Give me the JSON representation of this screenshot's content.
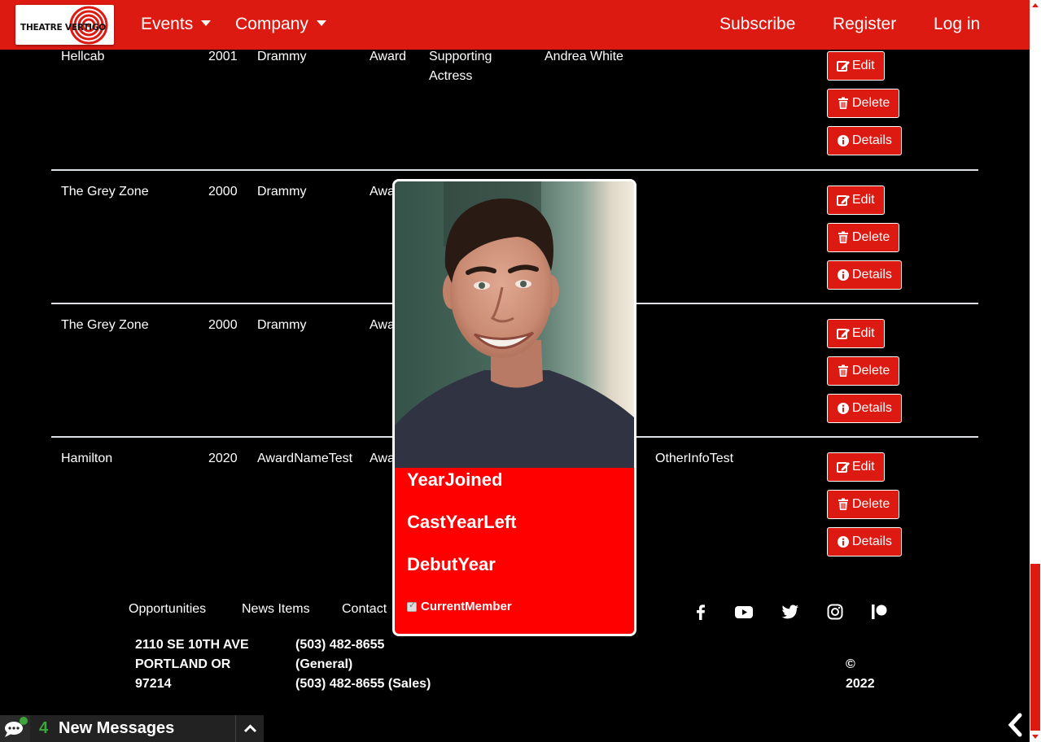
{
  "brand": {
    "logo_text": "THEATRE VERTIGO"
  },
  "nav": {
    "events": "Events",
    "company": "Company",
    "subscribe": "Subscribe",
    "register": "Register",
    "login": "Log in"
  },
  "table": {
    "rows": [
      {
        "production": "Hellcab",
        "year": "2001",
        "award_name": "Drammy",
        "type": "Award",
        "category_line1": "Supporting",
        "category_line2": "Actress",
        "recipient": "Andrea White",
        "other_info": ""
      },
      {
        "production": "The Grey Zone",
        "year": "2000",
        "award_name": "Drammy",
        "type": "Awa",
        "category_line1": "",
        "category_line2": "",
        "recipient": "",
        "other_info": ""
      },
      {
        "production": "The Grey Zone",
        "year": "2000",
        "award_name": "Drammy",
        "type": "Awa",
        "category_line1": "",
        "category_line2": "",
        "recipient": "",
        "other_info": ""
      },
      {
        "production": "Hamilton",
        "year": "2020",
        "award_name": "AwardNameTest",
        "type": "Awa",
        "category_line1": "",
        "category_line2": "",
        "recipient": "",
        "other_info": "OtherInfoTest"
      }
    ],
    "actions": {
      "edit": "Edit",
      "delete": "Delete",
      "details": "Details"
    }
  },
  "popup": {
    "photo_icon": "portrait-photo",
    "year_joined": "YearJoined",
    "cast_year_left": "CastYearLeft",
    "debut_year": "DebutYear",
    "current_member": "CurrentMember",
    "current_member_checked": true
  },
  "footer": {
    "links": [
      "Opportunities",
      "News Items",
      "Contact"
    ],
    "address": [
      "2110 SE 10TH AVE",
      "PORTLAND OR",
      "97214"
    ],
    "phones": [
      "(503) 482-8655",
      "(General)",
      "(503) 482-8655 (Sales)"
    ],
    "copyright": [
      "©",
      "2022"
    ],
    "social_icons": [
      "facebook-icon",
      "youtube-icon",
      "twitter-icon",
      "instagram-icon",
      "patreon-icon"
    ]
  },
  "chat": {
    "count": "4",
    "label": "New Messages"
  },
  "colors": {
    "brand_red": "#dc1a12",
    "popup_red": "#fe0000",
    "chat_green": "#3ca63c"
  }
}
